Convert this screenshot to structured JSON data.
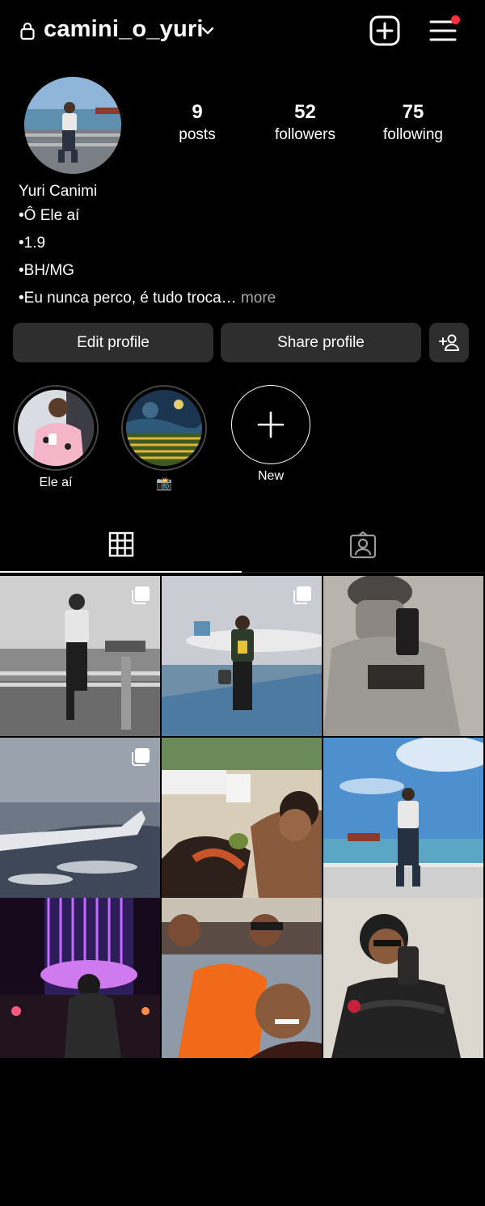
{
  "header": {
    "username": "camini_o_yuri"
  },
  "profile": {
    "stats": [
      {
        "value": "9",
        "label": "posts"
      },
      {
        "value": "52",
        "label": "followers"
      },
      {
        "value": "75",
        "label": "following"
      }
    ],
    "name": "Yuri Canimi",
    "bio_lines": [
      "•Ô Ele aí",
      "•1.9",
      "•BH/MG",
      "•Eu nunca perco, é tudo troca…"
    ],
    "bio_more": "more"
  },
  "buttons": {
    "edit_profile": "Edit profile",
    "share_profile": "Share profile"
  },
  "highlights": [
    {
      "label": "Ele aí"
    },
    {
      "label": "📸"
    },
    {
      "label": "New"
    }
  ],
  "colors": {
    "background": "#000000",
    "button_bg": "#2e2e2e",
    "notification_dot": "#ff3040",
    "muted_text": "#a8a8a8"
  },
  "icons": {
    "lock": "lock-icon",
    "dropdown": "chevron-down-icon",
    "create": "plus-square-icon",
    "menu": "hamburger-menu-icon",
    "discover_people": "add-person-icon",
    "posts_tab": "grid-icon",
    "tagged_tab": "tagged-person-icon",
    "multi_photo": "carousel-icon"
  }
}
